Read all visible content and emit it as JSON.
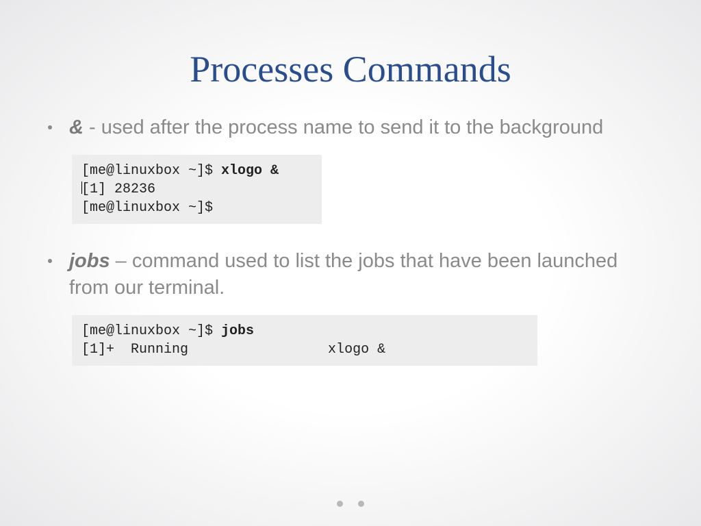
{
  "title": "Processes Commands",
  "bullets": [
    {
      "cmd": "&",
      "desc": " - used after the process name to send it to the background"
    },
    {
      "cmd": "jobs",
      "desc": " – command used to list the jobs that have been launched from our terminal."
    }
  ],
  "terminals": [
    {
      "line1_prompt": "[me@linuxbox ~]$ ",
      "line1_cmd": "xlogo &",
      "line2": "[1] 28236",
      "line3": "[me@linuxbox ~]$"
    },
    {
      "line1_prompt": "[me@linuxbox ~]$ ",
      "line1_cmd": "jobs",
      "line2": "[1]+  Running                 xlogo &"
    }
  ]
}
